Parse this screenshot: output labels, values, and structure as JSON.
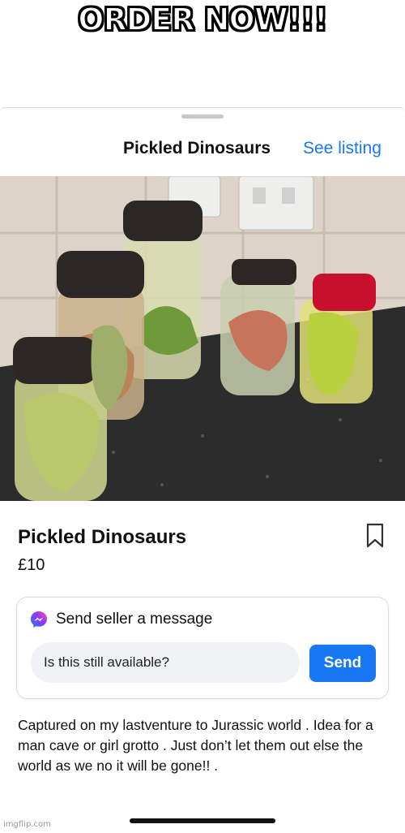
{
  "meme": {
    "caption": "ORDER NOW!!!",
    "watermark": "imgflip.com"
  },
  "header": {
    "title": "Pickled Dinosaurs",
    "see_listing_label": "See listing"
  },
  "photo": {
    "subject": "glass jars containing toy dinosaurs submerged in liquid on a granite countertop",
    "lid_colors": [
      "#2c2624",
      "#2c2624",
      "#2c2624",
      "#2c2624",
      "#c8102e"
    ]
  },
  "listing": {
    "title": "Pickled Dinosaurs",
    "price": "£10",
    "bookmark_icon": "bookmark-icon"
  },
  "message": {
    "header_label": "Send seller a message",
    "input_value": "Is this still available?",
    "send_label": "Send",
    "icon": "messenger-icon"
  },
  "description": "Captured on my lastventure to Jurassic world . Idea for a man cave or girl grotto . Just don’t let them out else the world as we no it will be gone!! .",
  "colors": {
    "accent": "#1877f2",
    "input_bg": "#f0f2f5"
  }
}
